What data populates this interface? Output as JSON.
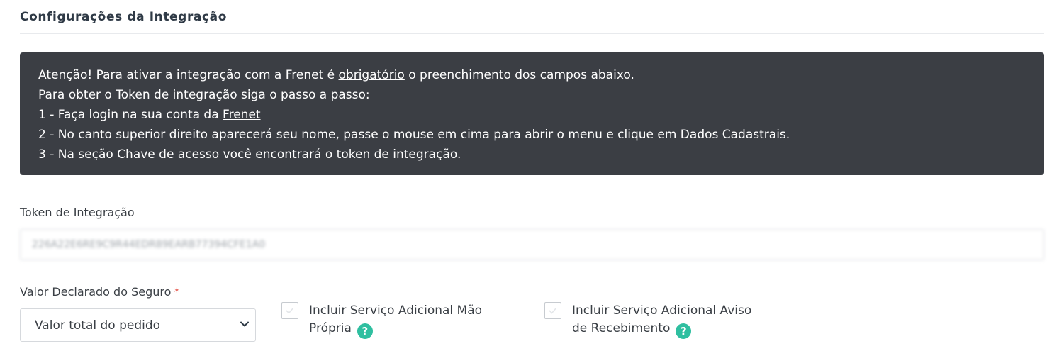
{
  "section": {
    "title": "Configurações da Integração"
  },
  "alert": {
    "line1_before": "Atenção! Para ativar a integração com a Frenet é ",
    "line1_link": "obrigatório",
    "line1_after": " o preenchimento dos campos abaixo.",
    "line2": "Para obter o Token de integração siga o passo a passo:",
    "line3_before": "1 - Faça login na sua conta da ",
    "line3_link": "Frenet",
    "line4": "2 - No canto superior direito aparecerá seu nome, passe o mouse em cima para abrir o menu e clique em Dados Cadastrais.",
    "line5": "3 - Na seção Chave de acesso você encontrará o token de integração."
  },
  "token": {
    "label": "Token de Integração",
    "value": "226A22E6RE9C9R44EDR89EARB77394CFE1A0"
  },
  "insurance": {
    "label": "Valor Declarado do Seguro",
    "required_mark": "*",
    "selected": "Valor total do pedido"
  },
  "options": {
    "own_hand": {
      "line1": "Incluir Serviço Adicional Mão",
      "line2": "Própria",
      "help_glyph": "?"
    },
    "receipt_notice": {
      "line1": "Incluir Serviço Adicional Aviso",
      "line2": "de Recebimento",
      "help_glyph": "?"
    }
  },
  "colors": {
    "alert_bg": "#3b3e44",
    "help_icon": "#2fbfa0",
    "required": "#e2483d"
  }
}
